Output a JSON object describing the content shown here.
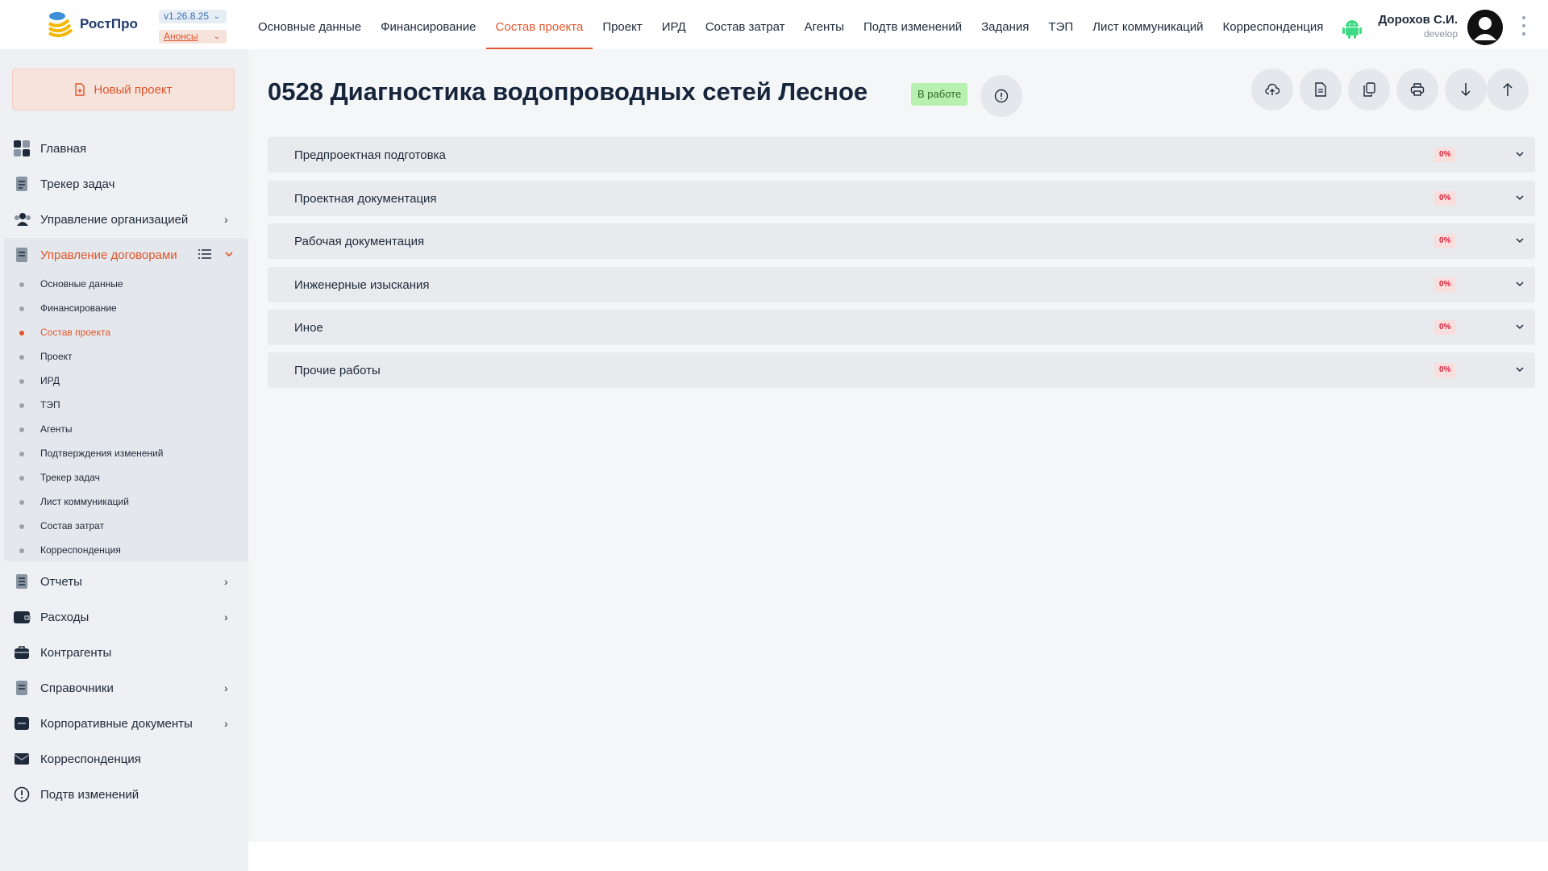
{
  "app": {
    "logo_text": "РостПро",
    "version": "v1.26.8.25",
    "announcements": "Анонсы"
  },
  "topnav": {
    "items": [
      {
        "label": "Основные данные"
      },
      {
        "label": "Финансирование"
      },
      {
        "label": "Состав проекта",
        "active": true
      },
      {
        "label": "Проект"
      },
      {
        "label": "ИРД"
      },
      {
        "label": "Состав затрат"
      },
      {
        "label": "Агенты"
      },
      {
        "label": "Подтв изменений"
      },
      {
        "label": "Задания"
      },
      {
        "label": "ТЭП"
      },
      {
        "label": "Лист коммуникаций"
      },
      {
        "label": "Корреспонденция"
      }
    ]
  },
  "user": {
    "name": "Дорохов С.И.",
    "role": "develop"
  },
  "sidebar": {
    "new_project": "Новый проект",
    "items": [
      {
        "label": "Главная",
        "icon": "dashboard-icon"
      },
      {
        "label": "Трекер задач",
        "icon": "task-tracker-icon"
      },
      {
        "label": "Управление организацией",
        "icon": "organization-icon"
      },
      {
        "label": "Управление договорами",
        "icon": "contracts-icon"
      },
      {
        "label": "Отчеты",
        "icon": "reports-icon"
      },
      {
        "label": "Расходы",
        "icon": "wallet-icon"
      },
      {
        "label": "Контрагенты",
        "icon": "briefcase-icon"
      },
      {
        "label": "Справочники",
        "icon": "reference-icon"
      },
      {
        "label": "Корпоративные документы",
        "icon": "corporate-docs-icon"
      },
      {
        "label": "Корреспонденция",
        "icon": "mail-icon"
      },
      {
        "label": "Подтв изменений",
        "icon": "alert-circle-icon"
      }
    ],
    "contracts_sub": [
      {
        "label": "Основные данные"
      },
      {
        "label": "Финансирование"
      },
      {
        "label": "Состав проекта",
        "active": true
      },
      {
        "label": "Проект"
      },
      {
        "label": "ИРД"
      },
      {
        "label": "ТЭП"
      },
      {
        "label": "Агенты"
      },
      {
        "label": "Подтверждения изменений"
      },
      {
        "label": "Трекер задач"
      },
      {
        "label": "Лист коммуникаций"
      },
      {
        "label": "Состав затрат"
      },
      {
        "label": "Корреспонденция"
      }
    ]
  },
  "main": {
    "title": "0528 Диагностика водопроводных сетей Лесное",
    "status": "В работе",
    "sections": [
      {
        "label": "Предпроектная подготовка",
        "progress": "0%"
      },
      {
        "label": "Проектная документация",
        "progress": "0%"
      },
      {
        "label": "Рабочая документация",
        "progress": "0%"
      },
      {
        "label": "Инженерные изыскания",
        "progress": "0%"
      },
      {
        "label": "Иное",
        "progress": "0%"
      },
      {
        "label": "Прочие работы",
        "progress": "0%"
      }
    ]
  },
  "colors": {
    "accent": "#e2552b",
    "status_bg": "#b8f0b0",
    "progress_text": "#d6243b"
  }
}
